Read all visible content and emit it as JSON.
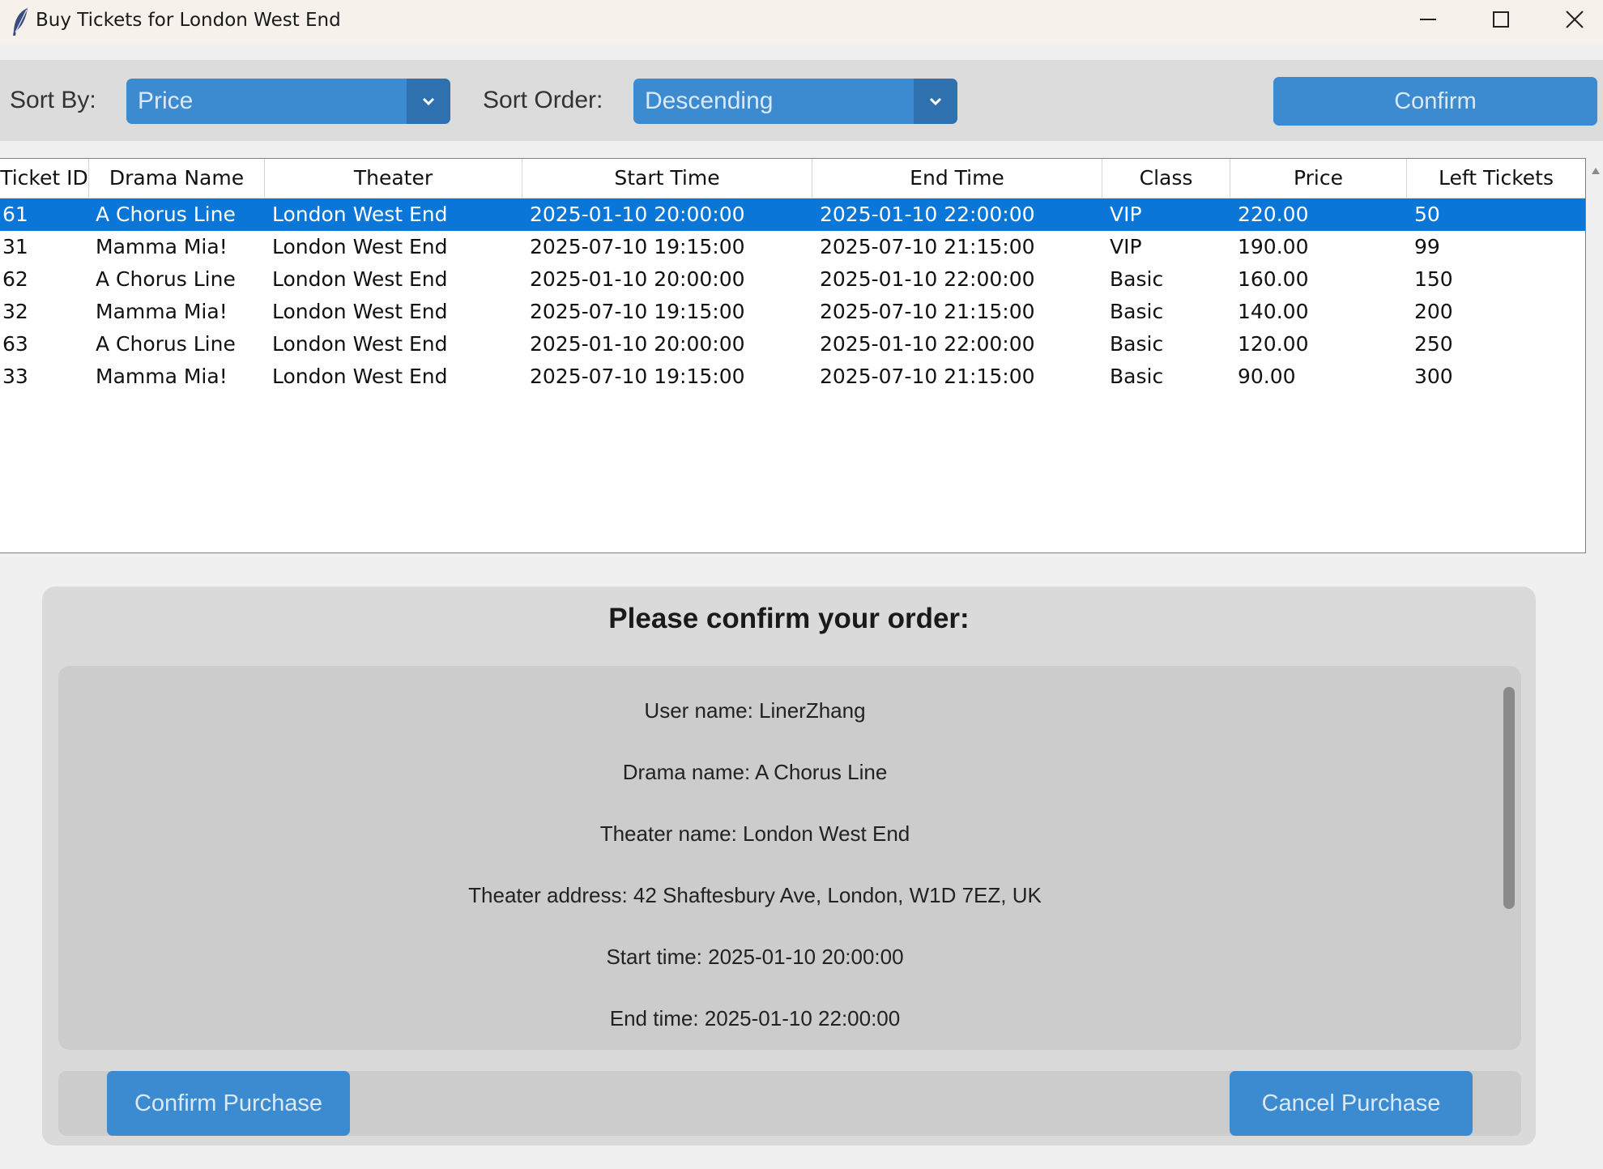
{
  "window": {
    "title": "Buy Tickets for London West End",
    "app_icon": "feather-icon",
    "controls": [
      "minimize-icon",
      "maximize-icon",
      "close-icon"
    ]
  },
  "toolbar": {
    "sort_by_label": "Sort By:",
    "sort_by_value": "Price",
    "sort_order_label": "Sort Order:",
    "sort_order_value": "Descending",
    "confirm_label": "Confirm"
  },
  "table": {
    "columns": [
      "Ticket ID",
      "Drama Name",
      "Theater",
      "Start Time",
      "End Time",
      "Class",
      "Price",
      "Left Tickets"
    ],
    "selected_row": 0,
    "rows": [
      [
        "61",
        "A Chorus Line",
        "London West End",
        "2025-01-10 20:00:00",
        "2025-01-10 22:00:00",
        "VIP",
        "220.00",
        "50"
      ],
      [
        "31",
        "Mamma Mia!",
        "London West End",
        "2025-07-10 19:15:00",
        "2025-07-10 21:15:00",
        "VIP",
        "190.00",
        "99"
      ],
      [
        "62",
        "A Chorus Line",
        "London West End",
        "2025-01-10 20:00:00",
        "2025-01-10 22:00:00",
        "Basic",
        "160.00",
        "150"
      ],
      [
        "32",
        "Mamma Mia!",
        "London West End",
        "2025-07-10 19:15:00",
        "2025-07-10 21:15:00",
        "Basic",
        "140.00",
        "200"
      ],
      [
        "63",
        "A Chorus Line",
        "London West End",
        "2025-01-10 20:00:00",
        "2025-01-10 22:00:00",
        "Basic",
        "120.00",
        "250"
      ],
      [
        "33",
        "Mamma Mia!",
        "London West End",
        "2025-07-10 19:15:00",
        "2025-07-10 21:15:00",
        "Basic",
        "90.00",
        "300"
      ]
    ]
  },
  "confirm_panel": {
    "heading": "Please confirm your order:",
    "details": [
      "User name: LinerZhang",
      "Drama name: A Chorus Line",
      "Theater name: London West End",
      "Theater address: 42 Shaftesbury Ave, London, W1D 7EZ, UK",
      "Start time: 2025-01-10 20:00:00",
      "End time: 2025-01-10 22:00:00"
    ],
    "confirm_purchase_label": "Confirm Purchase",
    "cancel_purchase_label": "Cancel Purchase"
  },
  "colors": {
    "accent": "#3c8bd0",
    "accent_dark": "#2f71ae",
    "selection": "#0a76d8"
  }
}
